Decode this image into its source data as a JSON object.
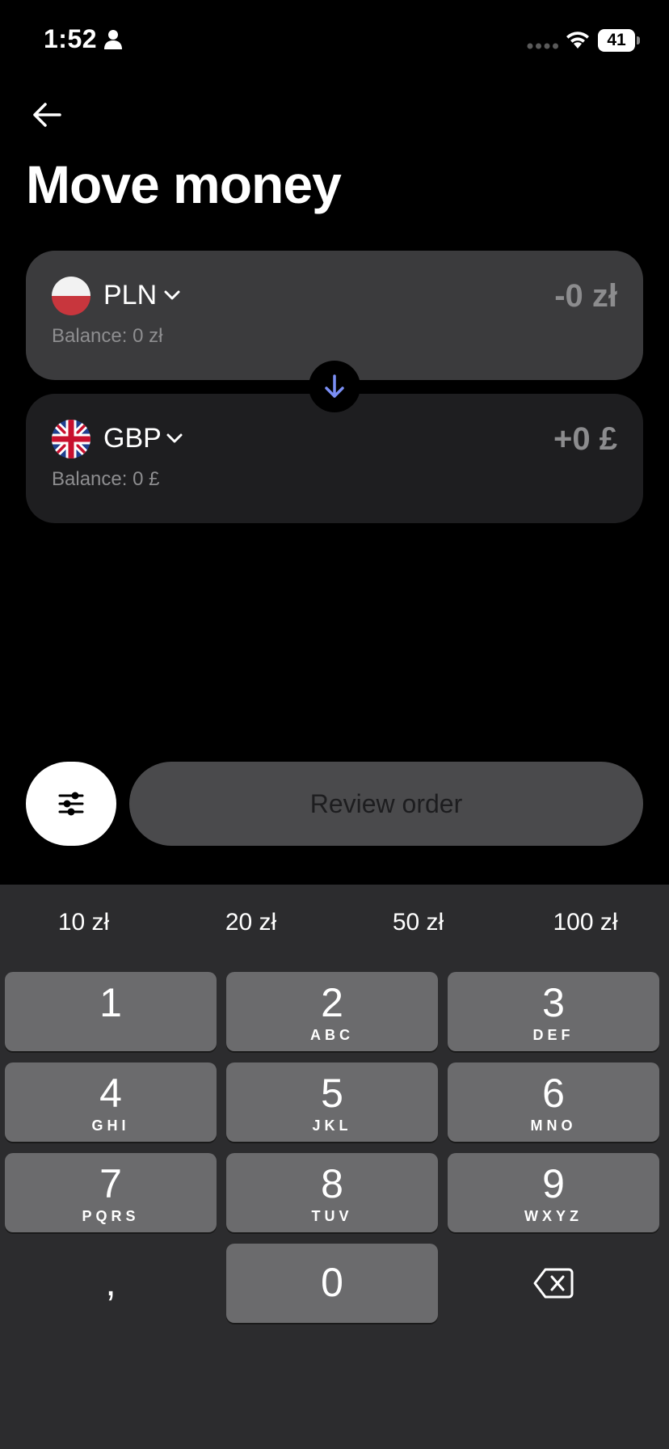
{
  "status_bar": {
    "time": "1:52",
    "battery": "41",
    "icons": [
      "person-icon",
      "signal-dots-icon",
      "wifi-icon",
      "battery-icon"
    ]
  },
  "header": {
    "back_icon": "arrow-left-icon",
    "title": "Move money"
  },
  "from_card": {
    "currency": "PLN",
    "flag": "poland-flag-icon",
    "amount": "-0 zł",
    "balance": "Balance: 0 zł"
  },
  "to_card": {
    "currency": "GBP",
    "flag": "uk-flag-icon",
    "amount": "+0 £",
    "balance": "Balance: 0 £"
  },
  "swap_icon": "arrow-down-icon",
  "actions": {
    "filter_icon": "sliders-icon",
    "review_label": "Review order"
  },
  "quick_amounts": [
    "10 zł",
    "20 zł",
    "50 zł",
    "100 zł"
  ],
  "keypad": {
    "keys": [
      {
        "num": "1",
        "letters": ""
      },
      {
        "num": "2",
        "letters": "ABC"
      },
      {
        "num": "3",
        "letters": "DEF"
      },
      {
        "num": "4",
        "letters": "GHI"
      },
      {
        "num": "5",
        "letters": "JKL"
      },
      {
        "num": "6",
        "letters": "MNO"
      },
      {
        "num": "7",
        "letters": "PQRS"
      },
      {
        "num": "8",
        "letters": "TUV"
      },
      {
        "num": "9",
        "letters": "WXYZ"
      },
      {
        "num": "0",
        "letters": ""
      }
    ],
    "decimal": ",",
    "backspace_icon": "backspace-icon"
  },
  "colors": {
    "background": "#000000",
    "card_from": "#3b3b3d",
    "card_to": "#1e1e20",
    "swap_arrow": "#7b8ff5",
    "keyboard_bg": "#2c2c2e",
    "key_bg": "#6b6b6d"
  }
}
